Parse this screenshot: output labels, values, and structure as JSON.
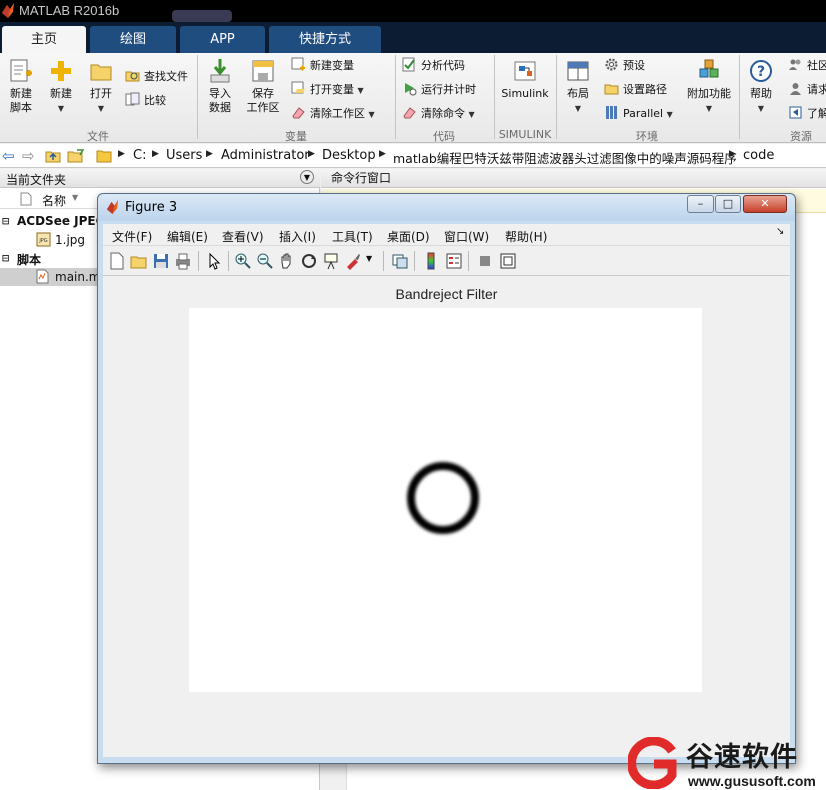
{
  "window": {
    "title": "MATLAB R2016b"
  },
  "tabs": [
    {
      "label": "主页",
      "active": true
    },
    {
      "label": "绘图",
      "active": false
    },
    {
      "label": "APP",
      "active": false
    },
    {
      "label": "快捷方式",
      "active": false
    }
  ],
  "ribbon": {
    "file": {
      "new_script": "新建\n脚本",
      "new": "新建",
      "open": "打开",
      "find_files": "查找文件",
      "compare": "比较",
      "section": "文件"
    },
    "variable": {
      "import_data": "导入\n数据",
      "save_workspace": "保存\n工作区",
      "new_variable": "新建变量",
      "open_variable": "打开变量",
      "clear_workspace": "清除工作区",
      "section": "变量"
    },
    "code": {
      "analyze_code": "分析代码",
      "run_and_time": "运行并计时",
      "clear_commands": "清除命令",
      "section": "代码"
    },
    "simulink": {
      "label": "Simulink",
      "section": "SIMULINK"
    },
    "environment": {
      "layout": "布局",
      "preferences": "预设",
      "set_path": "设置路径",
      "parallel": "Parallel",
      "addons": "附加功能",
      "section": "环境"
    },
    "resources": {
      "help": "帮助",
      "community": "社区",
      "request_support": "请求",
      "learn": "了解",
      "section": "资源"
    }
  },
  "address": {
    "crumbs": [
      "C:",
      "Users",
      "Administrator",
      "Desktop",
      "matlab编程巴特沃兹带阻滤波器头过滤图像中的噪声源码程序",
      "code"
    ]
  },
  "file_panel": {
    "title": "当前文件夹",
    "column_name": "名称",
    "group1": "ACDSee JPEG",
    "file1": "1.jpg",
    "group2": "脚本",
    "file2": "main.m"
  },
  "command_window": {
    "title": "命令行窗口"
  },
  "figure": {
    "title": "Figure 3",
    "menu": [
      "文件(F)",
      "编辑(E)",
      "查看(V)",
      "插入(I)",
      "工具(T)",
      "桌面(D)",
      "窗口(W)",
      "帮助(H)"
    ],
    "axes_title": "Bandreject Filter"
  },
  "watermark": {
    "brand": "谷速软件",
    "url": "www.gususoft.com"
  },
  "colors": {
    "tab_active": "#f5f5f5",
    "tab_inactive": "#1f4d80",
    "tab_strip": "#0b1c33",
    "watermark_red": "#e12a2a"
  }
}
